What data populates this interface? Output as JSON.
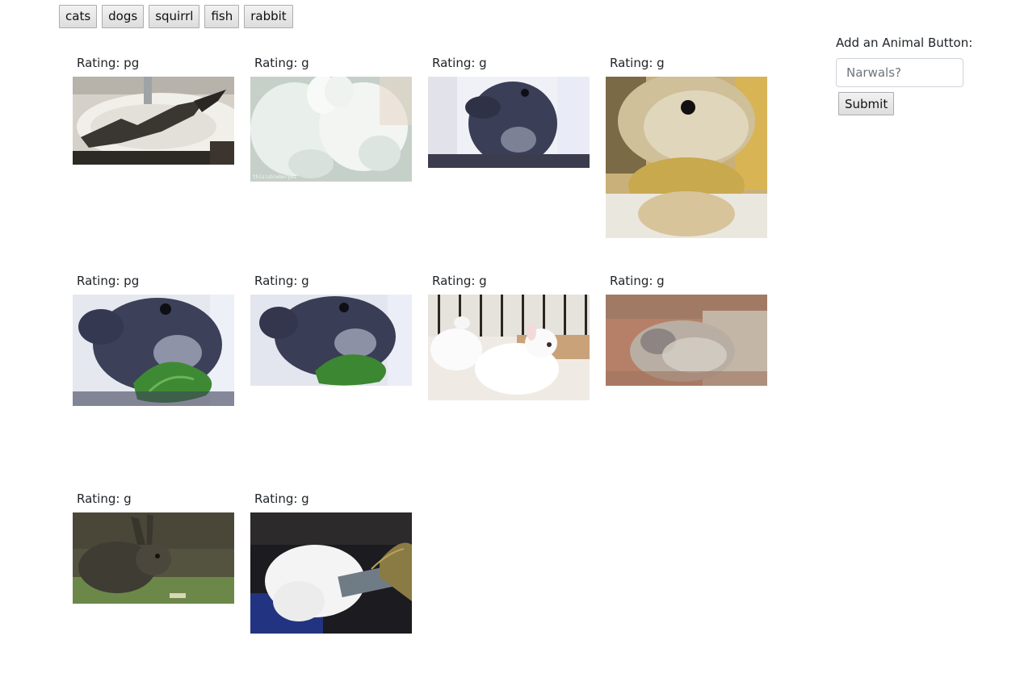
{
  "topics": [
    "cats",
    "dogs",
    "squirrl",
    "fish",
    "rabbit"
  ],
  "form": {
    "label": "Add an Animal Button:",
    "placeholder": "Narwals?",
    "value": "",
    "submit_label": "Submit"
  },
  "gifs": [
    {
      "rating": "Rating: pg",
      "desc": "rabbit-in-sink",
      "watermark": "",
      "colors": [
        "#d9d4cc",
        "#5a5650",
        "#2e2a26"
      ]
    },
    {
      "rating": "Rating: g",
      "desc": "two-white-rabbits",
      "watermark": "thisisbieberyes",
      "colors": [
        "#e6ede8",
        "#cfd8d2",
        "#a9b6ae"
      ]
    },
    {
      "rating": "Rating: g",
      "desc": "grey-rabbit",
      "watermark": "",
      "colors": [
        "#eef0f6",
        "#3b3f55",
        "#262838"
      ]
    },
    {
      "rating": "Rating: g",
      "desc": "tan-rabbit-closeup",
      "watermark": "",
      "colors": [
        "#c8b37d",
        "#b89a55",
        "#efeee8"
      ]
    },
    {
      "rating": "Rating: pg",
      "desc": "grey-rabbit-eating",
      "watermark": "",
      "colors": [
        "#e7e9f1",
        "#3a3e58",
        "#3f8a35"
      ]
    },
    {
      "rating": "Rating: g",
      "desc": "grey-rabbit-eating-2",
      "watermark": "",
      "colors": [
        "#e4e6ef",
        "#373a52",
        "#3b8732"
      ]
    },
    {
      "rating": "Rating: g",
      "desc": "white-bunnies-cage",
      "watermark": "",
      "colors": [
        "#f1ede6",
        "#c9a37a",
        "#fbfbfb"
      ]
    },
    {
      "rating": "Rating: g",
      "desc": "blurry-rabbit",
      "watermark": "",
      "colors": [
        "#b07860",
        "#a89a8a",
        "#c6bdb1"
      ]
    },
    {
      "rating": "Rating: g",
      "desc": "wild-hare",
      "watermark": "",
      "colors": [
        "#5f5f52",
        "#4c4a40",
        "#6d8a4c"
      ]
    },
    {
      "rating": "Rating: g",
      "desc": "white-rabbit-hay",
      "watermark": "",
      "colors": [
        "#1e1d22",
        "#f2f2f2",
        "#2a3a8a"
      ]
    }
  ]
}
